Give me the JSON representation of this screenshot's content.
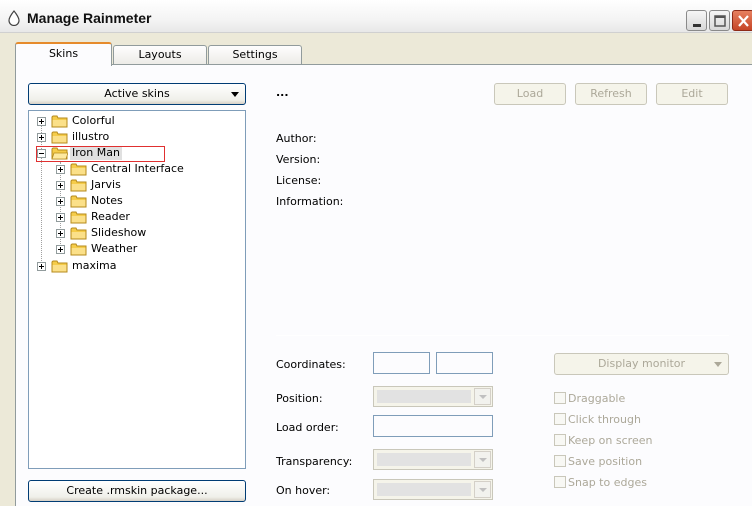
{
  "window": {
    "title": "Manage Rainmeter"
  },
  "tabs": [
    {
      "label": "Skins",
      "active": true
    },
    {
      "label": "Layouts",
      "active": false
    },
    {
      "label": "Settings",
      "active": false
    }
  ],
  "skins_panel": {
    "active_skins_label": "Active skins",
    "create_package_label": "Create .rmskin package...",
    "tree": [
      {
        "label": "Colorful",
        "expanded": false,
        "level": 0
      },
      {
        "label": "illustro",
        "expanded": false,
        "level": 0
      },
      {
        "label": "Iron Man",
        "expanded": true,
        "level": 0,
        "selected": true
      },
      {
        "label": "Central Interface",
        "expanded": false,
        "level": 1
      },
      {
        "label": "Jarvis",
        "expanded": false,
        "level": 1
      },
      {
        "label": "Notes",
        "expanded": false,
        "level": 1
      },
      {
        "label": "Reader",
        "expanded": false,
        "level": 1
      },
      {
        "label": "Slideshow",
        "expanded": false,
        "level": 1
      },
      {
        "label": "Weather",
        "expanded": false,
        "level": 1
      },
      {
        "label": "maxima",
        "expanded": false,
        "level": 0
      }
    ]
  },
  "details": {
    "skin_name": "...",
    "load_label": "Load",
    "refresh_label": "Refresh",
    "edit_label": "Edit",
    "author_label": "Author:",
    "version_label": "Version:",
    "license_label": "License:",
    "information_label": "Information:"
  },
  "settings": {
    "coordinates_label": "Coordinates:",
    "position_label": "Position:",
    "load_order_label": "Load order:",
    "transparency_label": "Transparency:",
    "on_hover_label": "On hover:",
    "display_monitor_label": "Display monitor",
    "checkboxes": [
      {
        "label": "Draggable",
        "checked": false
      },
      {
        "label": "Click through",
        "checked": false
      },
      {
        "label": "Keep on screen",
        "checked": false
      },
      {
        "label": "Save position",
        "checked": false
      },
      {
        "label": "Snap to edges",
        "checked": false
      }
    ]
  },
  "colors": {
    "tab_accent": "#e68b2c",
    "selection_outline": "#e03030",
    "folder": "#f5cc4a"
  }
}
